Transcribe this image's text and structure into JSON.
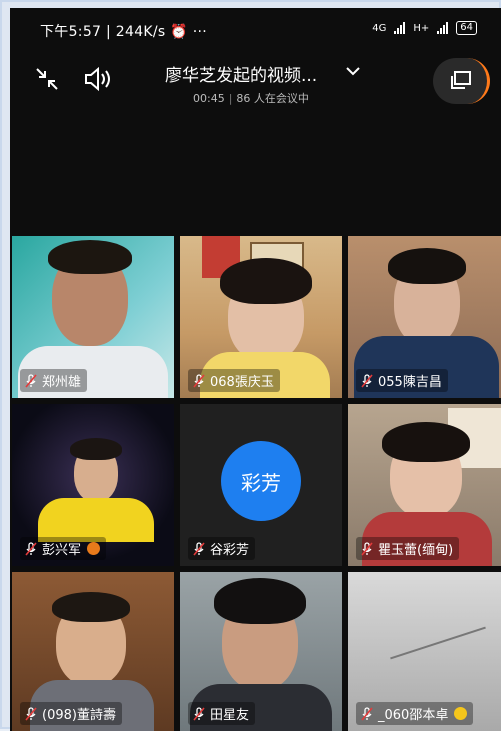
{
  "status_bar": {
    "time": "下午5:57",
    "speed": "244K/s",
    "network1": "4G",
    "network2": "H+",
    "battery": "64"
  },
  "header": {
    "title": "廖华芝发起的视频...",
    "duration": "00:45",
    "participants": "86 人在会议中"
  },
  "participants": [
    {
      "name": "郑州雄"
    },
    {
      "name": "068張庆玉"
    },
    {
      "name": "055陳吉昌"
    },
    {
      "name": "彭兴军"
    },
    {
      "name": "谷彩芳",
      "avatar_text": "彩芳"
    },
    {
      "name": "瞿玉蕾(缅甸)"
    },
    {
      "name": "(098)董詩壽"
    },
    {
      "name": "田星友"
    },
    {
      "name": "_060邵本卓"
    }
  ],
  "colors": {
    "avatar": "#1e7ff0",
    "accent": "#ff7a1a"
  }
}
